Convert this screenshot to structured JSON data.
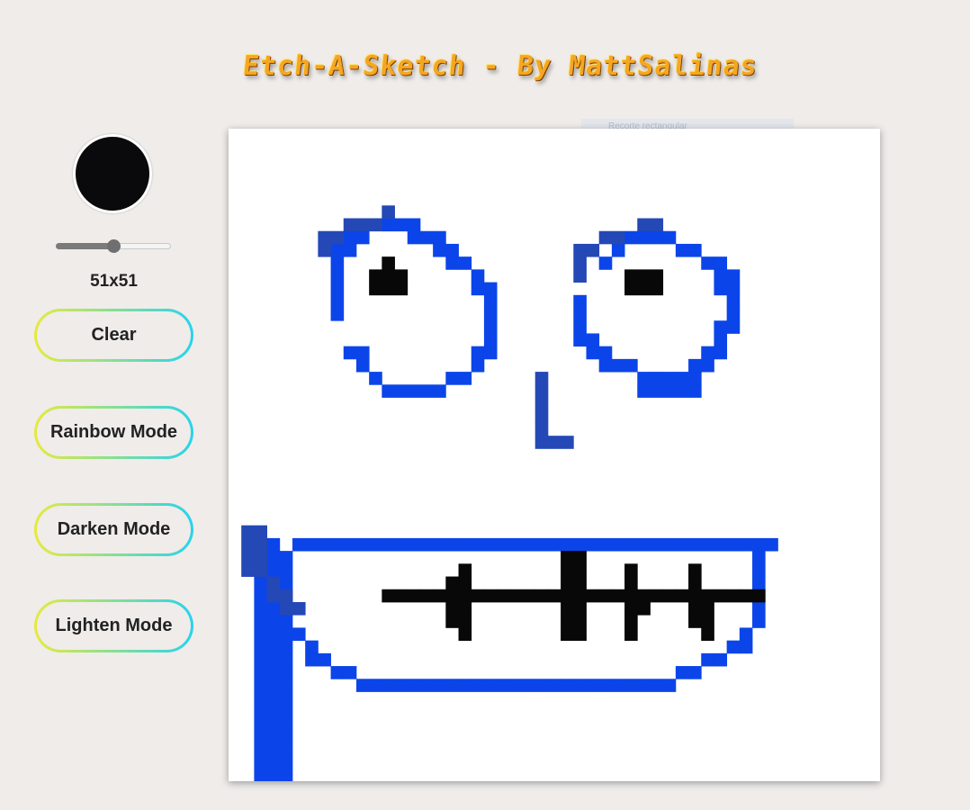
{
  "header": {
    "title": "Etch-A-Sketch - By MattSalinas"
  },
  "overlay": {
    "tooltip_text": "Recorte rectangular"
  },
  "controls": {
    "current_color": "#0a0a0c",
    "grid_size_label": "51x51",
    "grid_size_fraction": 0.5,
    "buttons": {
      "clear": "Clear",
      "rainbow": "Rainbow Mode",
      "darken": "Darken Mode",
      "lighten": "Lighten Mode"
    }
  },
  "sketch": {
    "grid": 51,
    "background": "#ffffff",
    "colors": {
      "blue": "#0b45e9",
      "darkblue": "#2448b6",
      "black": "#080808"
    },
    "cells": {
      "blue": [
        "12,7",
        "13,7",
        "14,7",
        "9,8",
        "10,8",
        "14,8",
        "15,8",
        "16,8",
        "8,9",
        "9,9",
        "16,9",
        "17,9",
        "8,10",
        "17,10",
        "18,10",
        "8,11",
        "19,11",
        "8,12",
        "19,12",
        "20,12",
        "8,13",
        "20,13",
        "8,14",
        "20,14",
        "20,15",
        "20,16",
        "9,17",
        "10,17",
        "19,17",
        "20,17",
        "10,18",
        "19,18",
        "11,19",
        "17,19",
        "18,19",
        "12,20",
        "13,20",
        "14,20",
        "15,20",
        "16,20",
        "31,8",
        "32,8",
        "33,8",
        "34,8",
        "30,9",
        "35,9",
        "36,9",
        "29,10",
        "37,10",
        "38,10",
        "38,11",
        "39,11",
        "38,12",
        "39,12",
        "27,13",
        "39,13",
        "27,14",
        "39,14",
        "27,15",
        "38,15",
        "39,15",
        "27,16",
        "28,16",
        "38,16",
        "28,17",
        "29,17",
        "37,17",
        "38,17",
        "29,18",
        "30,18",
        "31,18",
        "36,18",
        "37,18",
        "32,19",
        "33,19",
        "34,19",
        "35,19",
        "36,19",
        "32,20",
        "33,20",
        "34,20",
        "35,20",
        "36,20",
        "3,32",
        "3,33",
        "3,34",
        "3,35",
        "3,36",
        "3,37",
        "3,38",
        "3,39",
        "3,40",
        "3,41",
        "3,42",
        "3,43",
        "3,44",
        "3,45",
        "3,46",
        "3,47",
        "3,48",
        "3,49",
        "3,50",
        "2,33",
        "4,33",
        "2,34",
        "4,34",
        "2,35",
        "4,35",
        "2,36",
        "4,36",
        "2,37",
        "4,37",
        "2,38",
        "4,38",
        "2,39",
        "4,39",
        "2,40",
        "4,40",
        "2,41",
        "4,41",
        "2,42",
        "4,42",
        "2,43",
        "4,43",
        "2,44",
        "4,44",
        "2,45",
        "4,45",
        "2,46",
        "4,46",
        "2,47",
        "4,47",
        "2,48",
        "4,48",
        "2,49",
        "4,49",
        "2,50",
        "4,50",
        "5,32",
        "6,32",
        "7,32",
        "8,32",
        "9,32",
        "10,32",
        "11,32",
        "12,32",
        "13,32",
        "14,32",
        "15,32",
        "16,32",
        "17,32",
        "18,32",
        "19,32",
        "20,32",
        "21,32",
        "22,32",
        "23,32",
        "24,32",
        "25,32",
        "26,32",
        "27,32",
        "28,32",
        "29,32",
        "30,32",
        "31,32",
        "32,32",
        "33,32",
        "34,32",
        "35,32",
        "36,32",
        "37,32",
        "38,32",
        "39,32",
        "40,32",
        "41,32",
        "42,32",
        "3,32",
        "41,33",
        "3,33",
        "41,34",
        "3,34",
        "41,35",
        "3,35",
        "41,36",
        "3,36",
        "41,37",
        "3,37",
        "41,38",
        "4,38",
        "41,38",
        "4,39",
        "40,39",
        "5,39",
        "40,40",
        "6,40",
        "39,40",
        "6,41",
        "38,41",
        "7,41",
        "37,41",
        "8,42",
        "36,42",
        "9,42",
        "35,42",
        "10,43",
        "34,43",
        "11,43",
        "12,43",
        "13,43",
        "14,43",
        "15,43",
        "16,43",
        "17,43",
        "18,43",
        "19,43",
        "20,43",
        "21,43",
        "22,43",
        "23,43",
        "24,43",
        "25,43",
        "26,43",
        "27,43",
        "28,43",
        "29,43",
        "30,43",
        "31,43",
        "32,43",
        "33,43"
      ],
      "darkblue": [
        "12,6",
        "11,7",
        "10,7",
        "9,7",
        "8,8",
        "7,8",
        "7,9",
        "32,7",
        "33,7",
        "30,8",
        "29,8",
        "28,9",
        "27,9",
        "27,10",
        "27,11",
        "24,19",
        "24,20",
        "24,21",
        "24,22",
        "24,23",
        "24,24",
        "25,24",
        "26,24",
        "1,31",
        "2,31",
        "1,32",
        "2,32",
        "1,33",
        "2,33",
        "1,34",
        "2,34",
        "3,35",
        "3,36",
        "4,36",
        "4,37",
        "5,37"
      ],
      "black": [
        "12,10",
        "11,11",
        "12,11",
        "13,11",
        "11,12",
        "12,12",
        "13,12",
        "31,11",
        "32,11",
        "33,11",
        "31,12",
        "32,12",
        "33,12",
        "18,34",
        "18,35",
        "18,36",
        "18,37",
        "18,38",
        "18,39",
        "17,35",
        "17,36",
        "17,37",
        "17,38",
        "26,33",
        "27,33",
        "26,34",
        "27,34",
        "26,35",
        "27,35",
        "26,36",
        "27,36",
        "26,37",
        "27,37",
        "26,38",
        "27,38",
        "26,39",
        "27,39",
        "31,34",
        "31,35",
        "31,36",
        "31,37",
        "31,38",
        "31,39",
        "32,36",
        "32,37",
        "36,34",
        "36,35",
        "36,36",
        "36,37",
        "36,38",
        "37,36",
        "37,37",
        "37,38",
        "37,39",
        "12,36",
        "13,36",
        "14,36",
        "15,36",
        "16,36",
        "17,36",
        "18,36",
        "19,36",
        "20,36",
        "21,36",
        "22,36",
        "23,36",
        "24,36",
        "25,36",
        "26,36",
        "27,36",
        "28,36",
        "29,36",
        "30,36",
        "31,36",
        "32,36",
        "33,36",
        "34,36",
        "35,36",
        "36,36",
        "37,36",
        "38,36",
        "39,36",
        "40,36",
        "41,36"
      ]
    }
  }
}
